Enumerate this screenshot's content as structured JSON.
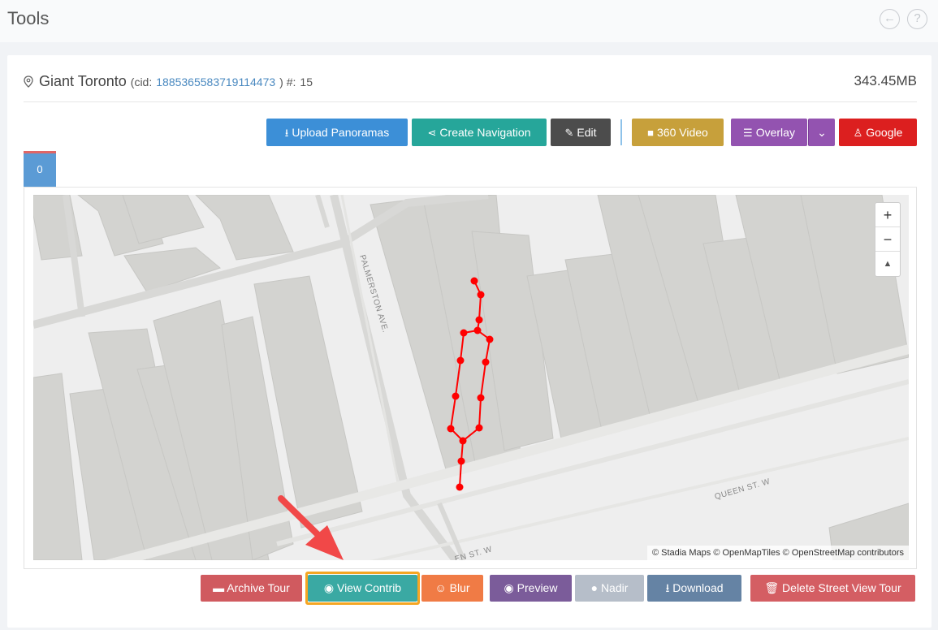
{
  "page": {
    "title": "Tools"
  },
  "header": {
    "tour_name": "Giant Toronto",
    "cid_prefix": "(cid:",
    "cid_value": "1885365583719114473",
    "cid_suffix": ") #:",
    "count": "15",
    "size": "343.45MB"
  },
  "toolbar": {
    "upload": "Upload Panoramas",
    "create_nav": "Create Navigation",
    "edit": "Edit",
    "video360": "360 Video",
    "overlay": "Overlay",
    "google": "Google"
  },
  "tabs": [
    {
      "label": "0"
    }
  ],
  "map": {
    "attribution": "© Stadia Maps © OpenMapTiles © OpenStreetMap contributors",
    "street_labels": [
      "PALMERSTON AVE.",
      "QUEEN ST. W",
      "EN ST. W"
    ],
    "zoom_in": "+",
    "zoom_out": "−",
    "reset_north": "▲"
  },
  "actions": {
    "archive": "Archive Tour",
    "view_contrib": "View Contrib",
    "blur": "Blur",
    "preview": "Preview",
    "nadir": "Nadir",
    "download": "Download",
    "delete": "Delete Street View Tour"
  },
  "colors": {
    "accent_blue": "#3c8fd7",
    "highlight": "#f5a623",
    "path_red": "#ff0000"
  }
}
